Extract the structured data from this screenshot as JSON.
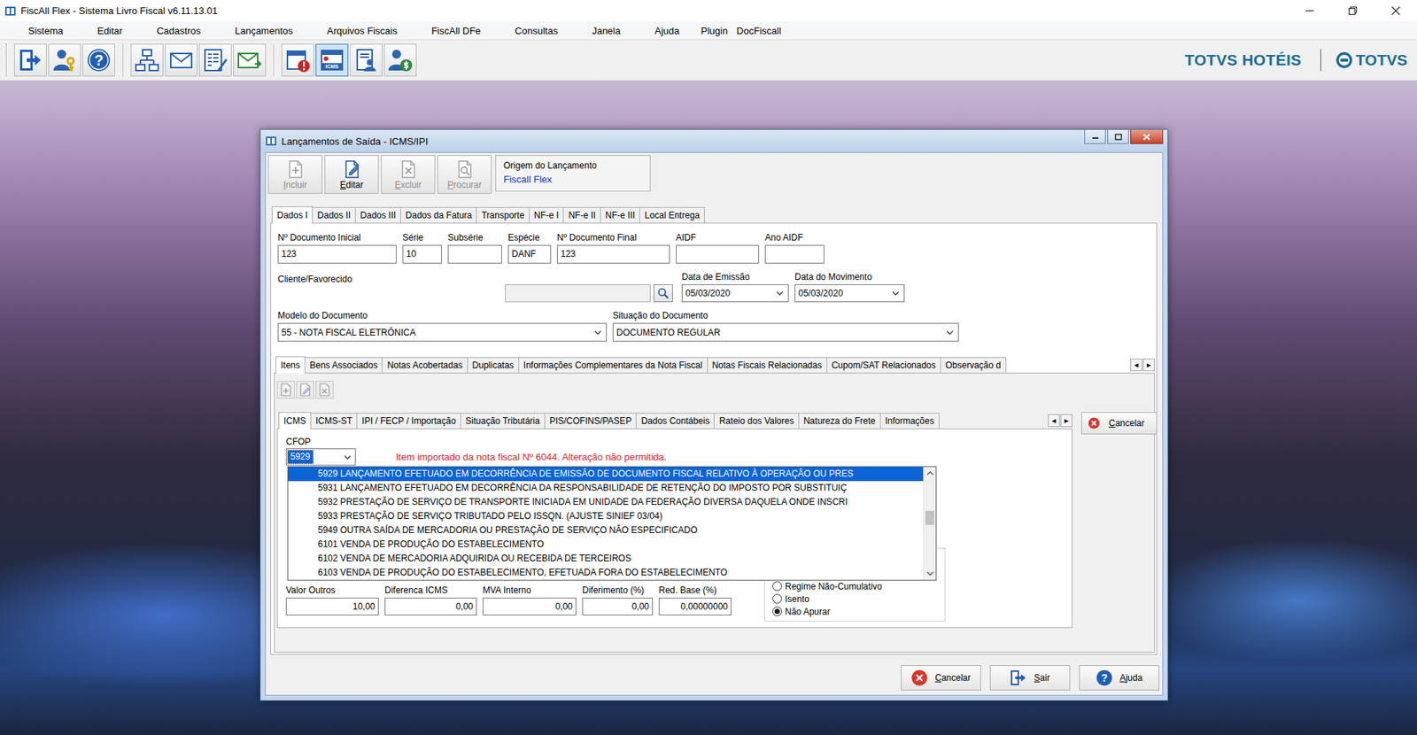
{
  "window": {
    "title": "FiscAll Flex - Sistema Livro Fiscal v6.11.13.01"
  },
  "menu": [
    "Sistema",
    "Editar",
    "Cadastros",
    "Lançamentos",
    "Arquivos Fiscais",
    "FiscAll DFe",
    "Consultas",
    "Janela",
    "Ajuda",
    "Plugin",
    "DocFiscall"
  ],
  "toolbar": [
    {
      "kind": "exit",
      "pressed": false
    },
    {
      "kind": "user-key",
      "pressed": false
    },
    {
      "kind": "help",
      "pressed": false
    },
    {
      "kind": "network",
      "pressed": false
    },
    {
      "kind": "mail",
      "pressed": false
    },
    {
      "kind": "form",
      "pressed": false
    },
    {
      "kind": "mail-send",
      "pressed": false
    },
    {
      "kind": "calendar-alert",
      "pressed": false
    },
    {
      "kind": "calendar-icms",
      "pressed": true,
      "badge": "ICMS"
    },
    {
      "kind": "person-doc",
      "pressed": false
    },
    {
      "kind": "person-money",
      "pressed": false
    }
  ],
  "help_glyph": "?",
  "brand": {
    "product": "TOTVS HOTÉIS",
    "company": "TOTVS"
  },
  "dialog": {
    "title": "Lançamentos de Saída - ICMS/IPI",
    "actions": [
      {
        "label": "Incluir",
        "kind": "new",
        "disabled": true
      },
      {
        "label": "Editar",
        "kind": "edit",
        "disabled": false
      },
      {
        "label": "Excluir",
        "kind": "delete",
        "disabled": true
      },
      {
        "label": "Procurar",
        "kind": "search",
        "disabled": true
      }
    ],
    "origin": {
      "label": "Origem do Lançamento",
      "value": "Fiscall Flex"
    },
    "tabs": [
      {
        "label": "Dados I",
        "selected": true
      },
      {
        "label": "Dados II",
        "selected": false
      },
      {
        "label": "Dados III",
        "selected": false
      },
      {
        "label": "Dados da Fatura",
        "selected": false
      },
      {
        "label": "Transporte",
        "selected": false
      },
      {
        "label": "NF-e I",
        "selected": false
      },
      {
        "label": "NF-e II",
        "selected": false
      },
      {
        "label": "NF-e III",
        "selected": false
      },
      {
        "label": "Local Entrega",
        "selected": false
      }
    ],
    "fields": [
      {
        "label": "Nº Documento Inicial",
        "value": "123"
      },
      {
        "label": "Série",
        "value": "10"
      },
      {
        "label": "Subsérie",
        "value": ""
      },
      {
        "label": "Espécie",
        "value": "DANF"
      },
      {
        "label": "Nº Documento Final",
        "value": "123"
      },
      {
        "label": "AIDF",
        "value": ""
      },
      {
        "label": "Ano AIDF",
        "value": ""
      }
    ],
    "client": {
      "label": "Cliente/Favorecido",
      "value": "",
      "disabled": true
    },
    "dates": [
      {
        "label": "Data de Emissão",
        "value": "05/03/2020"
      },
      {
        "label": "Data do Movimento",
        "value": "05/03/2020"
      }
    ],
    "selects": [
      {
        "label": "Modelo do Documento",
        "value": "55 - NOTA FISCAL ELETRÔNICA"
      },
      {
        "label": "Situação do Documento",
        "value": "DOCUMENTO REGULAR"
      }
    ],
    "item_tabs": [
      {
        "label": "Itens",
        "selected": true
      },
      {
        "label": "Bens Associados",
        "selected": false
      },
      {
        "label": "Notas Acobertadas",
        "selected": false
      },
      {
        "label": "Duplicatas",
        "selected": false
      },
      {
        "label": "Informações Complementares da Nota Fiscal",
        "selected": false
      },
      {
        "label": "Notas Fiscais Relacionadas",
        "selected": false
      },
      {
        "label": "Cupom/SAT Relacionados",
        "selected": false
      },
      {
        "label": "Observação d",
        "selected": false
      }
    ],
    "tab_arrows": [
      "◂",
      "▸"
    ],
    "item_tools": [
      {
        "kind": "new",
        "disabled": true
      },
      {
        "kind": "edit",
        "disabled": true
      },
      {
        "kind": "delete",
        "disabled": true
      }
    ],
    "detail_tabs": [
      {
        "label": "ICMS",
        "selected": true
      },
      {
        "label": "ICMS-ST",
        "selected": false
      },
      {
        "label": "IPI / FECP / Importação",
        "selected": false
      },
      {
        "label": "Situação Tributária",
        "selected": false
      },
      {
        "label": "PIS/COFINS/PASEP",
        "selected": false
      },
      {
        "label": "Dados Contábeis",
        "selected": false
      },
      {
        "label": "Rateio dos Valores",
        "selected": false
      },
      {
        "label": "Natureza do Frete",
        "selected": false
      },
      {
        "label": "Informações",
        "selected": false
      }
    ],
    "detail_cancel": "Cancelar",
    "cfop": {
      "label": "CFOP",
      "value": "5929",
      "message": "Item importado da nota fiscal Nº 6044. Alteração não permitida.",
      "open": true,
      "options": [
        {
          "text": "5929 LANÇAMENTO EFETUADO EM DECORRÊNCIA DE EMISSÃO DE DOCUMENTO FISCAL RELATIVO À OPERAÇÃO OU PRES",
          "selected": true
        },
        {
          "text": "5931 LANÇAMENTO EFETUADO EM DECORRÊNCIA DA RESPONSABILIDADE DE RETENÇÃO DO IMPOSTO POR SUBSTITUIÇ",
          "selected": false
        },
        {
          "text": "5932 PRESTAÇÃO DE SERVIÇO DE TRANSPORTE INICIADA EM UNIDADE DA FEDERAÇÃO DIVERSA DAQUELA ONDE INSCRI",
          "selected": false
        },
        {
          "text": "5933 PRESTAÇÃO DE SERVIÇO TRIBUTADO PELO ISSQN. (AJUSTE SINIEF 03/04)",
          "selected": false
        },
        {
          "text": "5949 OUTRA SAÍDA DE MERCADORIA OU PRESTAÇÃO DE SERVIÇO NÃO ESPECIFICADO",
          "selected": false
        },
        {
          "text": "6101 VENDA DE PRODUÇÃO DO ESTABELECIMENTO",
          "selected": false
        },
        {
          "text": "6102 VENDA DE MERCADORIA ADQUIRIDA OU RECEBIDA DE TERCEIROS",
          "selected": false
        },
        {
          "text": "6103 VENDA DE PRODUÇÃO DO ESTABELECIMENTO, EFETUADA FORA DO ESTABELECIMENTO",
          "selected": false
        }
      ],
      "scrollbar": {
        "position": 0.42,
        "size": 0.16
      }
    },
    "amounts": [
      {
        "label": "Valor Outros",
        "value": "10,00"
      },
      {
        "label": "Diferenca ICMS",
        "value": "0,00"
      },
      {
        "label": "MVA Interno",
        "value": "0,00"
      },
      {
        "label": "Diferimento (%)",
        "value": "0,00"
      },
      {
        "label": "Red. Base (%)",
        "value": "0,00000000"
      }
    ],
    "apuracao": [
      {
        "label": "Regime Não-Cumulativo",
        "selected": false
      },
      {
        "label": "Isento",
        "selected": false
      },
      {
        "label": "Não Apurar",
        "selected": true
      }
    ],
    "buttons": [
      {
        "label": "Cancelar",
        "kind": "cancel"
      },
      {
        "label": "Sair",
        "kind": "exit"
      },
      {
        "label": "Ajuda",
        "kind": "help"
      }
    ]
  }
}
